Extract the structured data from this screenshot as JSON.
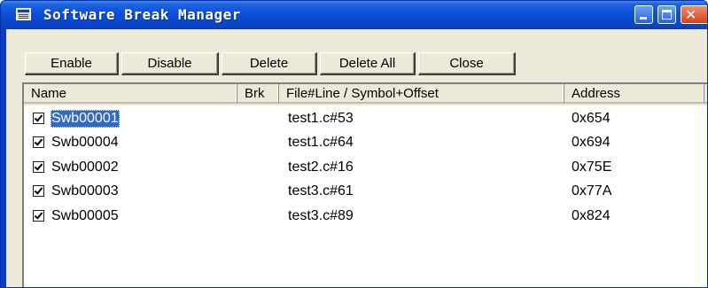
{
  "window": {
    "title": "Software Break Manager"
  },
  "toolbar": {
    "enable_label": "Enable",
    "disable_label": "Disable",
    "delete_label": "Delete",
    "delete_all_label": "Delete All",
    "close_label": "Close"
  },
  "columns": {
    "name": "Name",
    "brk": "Brk",
    "file": "File#Line / Symbol+Offset",
    "address": "Address"
  },
  "rows": [
    {
      "name": "Swb00001",
      "brk": "",
      "file": "test1.c#53",
      "address": "0x654",
      "checked": true,
      "selected": true
    },
    {
      "name": "Swb00004",
      "brk": "",
      "file": "test1.c#64",
      "address": "0x694",
      "checked": true,
      "selected": false
    },
    {
      "name": "Swb00002",
      "brk": "",
      "file": "test2.c#16",
      "address": "0x75E",
      "checked": true,
      "selected": false
    },
    {
      "name": "Swb00003",
      "brk": "",
      "file": "test3.c#61",
      "address": "0x77A",
      "checked": true,
      "selected": false
    },
    {
      "name": "Swb00005",
      "brk": "",
      "file": "test3.c#89",
      "address": "0x824",
      "checked": true,
      "selected": false
    }
  ],
  "icons": {
    "window_icon": "window-app-icon",
    "minimize": "minimize-icon",
    "maximize": "maximize-icon",
    "close": "close-icon",
    "checkbox": "checkbox-checked-icon"
  },
  "colors": {
    "titlebar": "#0b4fd8",
    "selection": "#316ac5",
    "face": "#ece9d8"
  }
}
